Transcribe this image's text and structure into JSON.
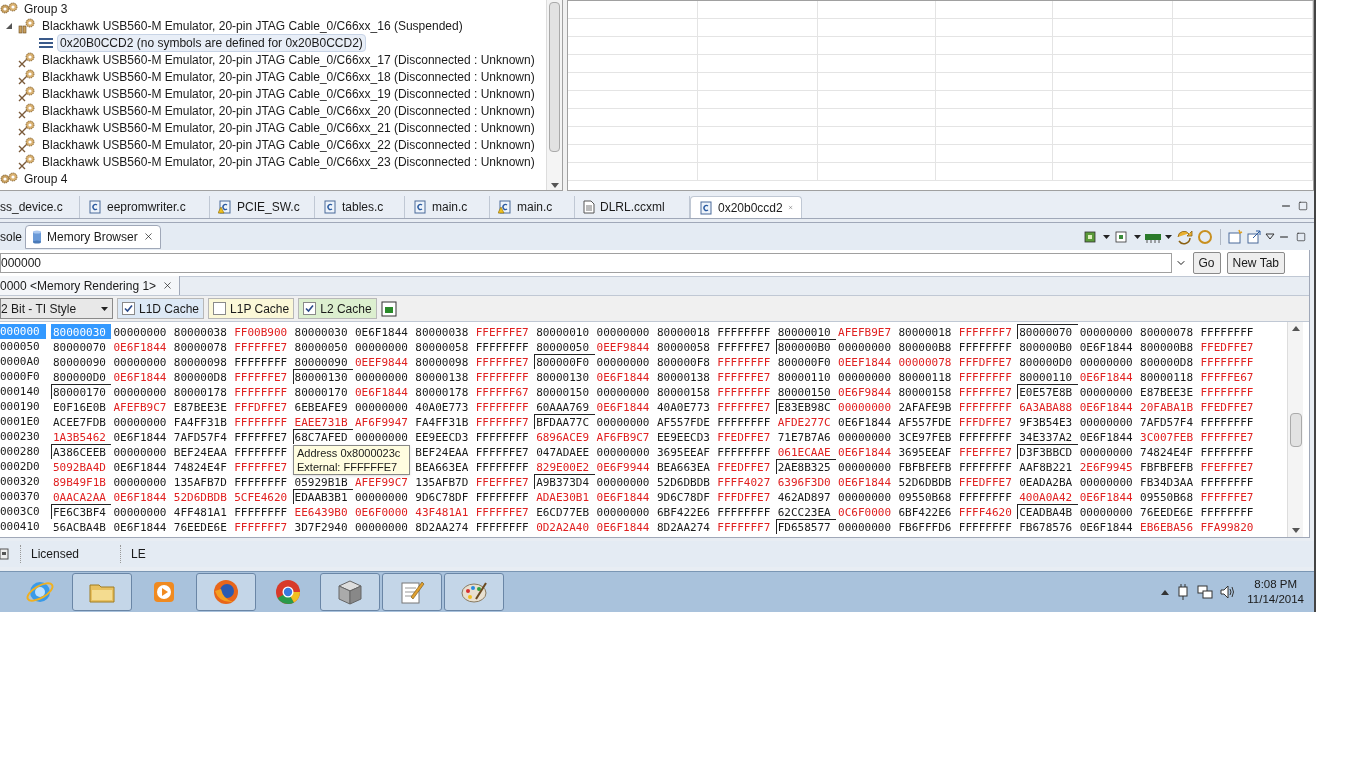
{
  "tree": [
    {
      "label": "Group 3",
      "kind": "group",
      "selected": false,
      "children": [
        {
          "label": "Blackhawk USB560-M Emulator, 20-pin JTAG Cable_0/C66xx_16 (Suspended)",
          "kind": "suspended",
          "selected": false,
          "children": [
            {
              "label": "0x20B0CCD2  (no symbols are defined for 0x20B0CCD2)",
              "kind": "frame",
              "selected": true
            }
          ]
        },
        {
          "label": "Blackhawk USB560-M Emulator, 20-pin JTAG Cable_0/C66xx_17 (Disconnected : Unknown)",
          "kind": "disconnected",
          "selected": false
        },
        {
          "label": "Blackhawk USB560-M Emulator, 20-pin JTAG Cable_0/C66xx_18 (Disconnected : Unknown)",
          "kind": "disconnected",
          "selected": false
        },
        {
          "label": "Blackhawk USB560-M Emulator, 20-pin JTAG Cable_0/C66xx_19 (Disconnected : Unknown)",
          "kind": "disconnected",
          "selected": false
        },
        {
          "label": "Blackhawk USB560-M Emulator, 20-pin JTAG Cable_0/C66xx_20 (Disconnected : Unknown)",
          "kind": "disconnected",
          "selected": false
        },
        {
          "label": "Blackhawk USB560-M Emulator, 20-pin JTAG Cable_0/C66xx_21 (Disconnected : Unknown)",
          "kind": "disconnected",
          "selected": false
        },
        {
          "label": "Blackhawk USB560-M Emulator, 20-pin JTAG Cable_0/C66xx_22 (Disconnected : Unknown)",
          "kind": "disconnected",
          "selected": false
        },
        {
          "label": "Blackhawk USB560-M Emulator, 20-pin JTAG Cable_0/C66xx_23 (Disconnected : Unknown)",
          "kind": "disconnected",
          "selected": false
        }
      ]
    },
    {
      "label": "Group 4",
      "kind": "group",
      "selected": false
    }
  ],
  "editor_tabs": [
    {
      "label": "ss_device.c",
      "kind": "none",
      "selected": false
    },
    {
      "label": "eepromwriter.c",
      "kind": "c",
      "selected": false
    },
    {
      "label": "PCIE_SW.c",
      "kind": "c-warning",
      "selected": false
    },
    {
      "label": "tables.c",
      "kind": "c",
      "selected": false
    },
    {
      "label": "main.c",
      "kind": "c",
      "selected": false
    },
    {
      "label": "main.c",
      "kind": "c-warning",
      "selected": false
    },
    {
      "label": "DLRL.ccxml",
      "kind": "xml",
      "selected": false
    },
    {
      "label": "0x20b0ccd2",
      "kind": "c",
      "selected": true
    }
  ],
  "view_tabs": [
    {
      "label": "sole",
      "kind": "none",
      "selected": false
    },
    {
      "label": "Memory Browser",
      "kind": "memory",
      "selected": true
    }
  ],
  "memory_browser": {
    "address": {
      "value": "000000"
    },
    "buttons": [
      "Go",
      "New Tab"
    ],
    "rendering_tab": "0000 <Memory Rendering 1>",
    "format": "2 Bit - TI Style",
    "caches": [
      {
        "label": "L1D Cache",
        "checked": true,
        "color": "#dde9f6"
      },
      {
        "label": "L1P Cache",
        "checked": false,
        "color": "#fbf8d8"
      },
      {
        "label": "L2 Cache",
        "checked": true,
        "color": "#dcefcf"
      }
    ],
    "rows": [
      {
        "address": "000000",
        "selected": true,
        "words": [
          "80000030",
          "00000000",
          "80000038",
          "FF00B900",
          "80000030",
          "0E6F1844",
          "80000038",
          "FFEFFFE7",
          "80000010",
          "00000000",
          "80000018",
          "FFFFFFFF",
          "80000010",
          "AFEFB9E7",
          "80000018",
          "FFFFFFF7",
          "80000070",
          "00000000",
          "80000078",
          "FFFFFFFF"
        ],
        "changed": [
          false,
          false,
          false,
          true,
          false,
          false,
          false,
          true,
          false,
          false,
          false,
          false,
          false,
          true,
          false,
          true,
          false,
          false,
          false,
          false
        ],
        "boxed": [
          false,
          false,
          false,
          false,
          false,
          false,
          false,
          false,
          false,
          false,
          false,
          false,
          false,
          false,
          false,
          false,
          true,
          false,
          false,
          false
        ]
      },
      {
        "address": "000050",
        "selected": false,
        "words": [
          "80000070",
          "0E6F1844",
          "80000078",
          "FFFFFFE7",
          "80000050",
          "00000000",
          "80000058",
          "FFFFFFFF",
          "80000050",
          "0EEF9844",
          "80000058",
          "FFFFFFE7",
          "800000B0",
          "00000000",
          "800000B8",
          "FFFFFFFF",
          "800000B0",
          "0E6F1844",
          "800000B8",
          "FFEDFFE7"
        ],
        "changed": [
          false,
          true,
          false,
          true,
          false,
          false,
          false,
          false,
          false,
          true,
          false,
          false,
          false,
          false,
          false,
          false,
          false,
          false,
          false,
          true
        ],
        "boxed": [
          false,
          false,
          false,
          false,
          false,
          false,
          false,
          false,
          false,
          false,
          false,
          false,
          true,
          false,
          false,
          false,
          false,
          false,
          false,
          false
        ]
      },
      {
        "address": "0000A0",
        "selected": false,
        "words": [
          "80000090",
          "00000000",
          "80000098",
          "FFFFFFFF",
          "80000090",
          "0EEF9844",
          "80000098",
          "FFFFFFE7",
          "800000F0",
          "00000000",
          "800000F8",
          "FFFFFFFF",
          "800000F0",
          "0EEF1844",
          "00000078",
          "FFFDFFE7",
          "800000D0",
          "00000000",
          "800000D8",
          "FFFFFFFF"
        ],
        "changed": [
          false,
          false,
          false,
          false,
          false,
          true,
          false,
          true,
          false,
          false,
          false,
          true,
          false,
          true,
          true,
          true,
          false,
          false,
          false,
          true
        ],
        "boxed": [
          false,
          false,
          false,
          false,
          false,
          false,
          false,
          false,
          true,
          false,
          false,
          false,
          false,
          false,
          false,
          false,
          false,
          false,
          false,
          false
        ]
      },
      {
        "address": "0000F0",
        "selected": false,
        "words": [
          "800000D0",
          "0E6F1844",
          "800000D8",
          "FFFFFFE7",
          "80000130",
          "00000000",
          "80000138",
          "FFFFFFFF",
          "80000130",
          "0E6F1844",
          "80000138",
          "FFFFFFE7",
          "80000110",
          "00000000",
          "80000118",
          "FFFFFFFF",
          "80000110",
          "0E6F1844",
          "80000118",
          "FFFFFE67"
        ],
        "changed": [
          false,
          true,
          false,
          true,
          false,
          false,
          false,
          true,
          false,
          true,
          false,
          true,
          false,
          false,
          false,
          true,
          false,
          true,
          false,
          true
        ],
        "boxed": [
          false,
          false,
          false,
          false,
          true,
          false,
          false,
          false,
          false,
          false,
          false,
          false,
          false,
          false,
          false,
          false,
          false,
          false,
          false,
          false
        ]
      },
      {
        "address": "000140",
        "selected": false,
        "words": [
          "80000170",
          "00000000",
          "80000178",
          "FFFFFFFF",
          "80000170",
          "0E6F1844",
          "80000178",
          "FFFFFF67",
          "80000150",
          "00000000",
          "80000158",
          "FFFFFFFF",
          "80000150",
          "0E6F9844",
          "80000158",
          "FFFFFFE7",
          "E0E57E8B",
          "00000000",
          "E87BEE3E",
          "FFFFFFFF"
        ],
        "changed": [
          false,
          false,
          false,
          true,
          false,
          true,
          false,
          true,
          false,
          false,
          false,
          true,
          false,
          true,
          false,
          true,
          false,
          false,
          false,
          true
        ],
        "boxed": [
          true,
          false,
          false,
          false,
          false,
          false,
          false,
          false,
          false,
          false,
          false,
          false,
          false,
          false,
          false,
          false,
          true,
          false,
          false,
          false
        ]
      },
      {
        "address": "000190",
        "selected": false,
        "words": [
          "E0F16E0B",
          "AFEFB9C7",
          "E87BEE3E",
          "FFFDFFE7",
          "6EBEAFE9",
          "00000000",
          "40A0E773",
          "FFFFFFFF",
          "60AAA769",
          "0E6F1844",
          "40A0E773",
          "FFFFFFE7",
          "E83EB98C",
          "00000000",
          "2AFAFE9B",
          "FFFFFFFF",
          "6A3ABA88",
          "0E6F1844",
          "20FABA1B",
          "FFEDFFE7"
        ],
        "changed": [
          false,
          true,
          false,
          true,
          false,
          false,
          false,
          true,
          false,
          true,
          false,
          true,
          false,
          true,
          false,
          true,
          true,
          true,
          true,
          true
        ],
        "boxed": [
          false,
          false,
          false,
          false,
          false,
          false,
          false,
          false,
          false,
          false,
          false,
          false,
          true,
          false,
          false,
          false,
          false,
          false,
          false,
          false
        ]
      },
      {
        "address": "0001E0",
        "selected": false,
        "words": [
          "ACEE7FDB",
          "00000000",
          "FA4FF31B",
          "FFFFFFFF",
          "EAEE731B",
          "AF6F9947",
          "FA4FF31B",
          "FFFFFFF7",
          "BFDAA77C",
          "00000000",
          "AF557FDE",
          "FFFFFFFF",
          "AFDE277C",
          "0E6F1844",
          "AF557FDE",
          "FFFDFFE7",
          "9F3B54E3",
          "00000000",
          "7AFD57F4",
          "FFFFFFFF"
        ],
        "changed": [
          false,
          false,
          false,
          true,
          true,
          true,
          false,
          true,
          false,
          false,
          false,
          false,
          true,
          false,
          false,
          true,
          false,
          false,
          false,
          false
        ],
        "boxed": [
          false,
          false,
          false,
          false,
          false,
          false,
          false,
          false,
          true,
          false,
          false,
          false,
          false,
          false,
          false,
          false,
          false,
          false,
          false,
          false
        ]
      },
      {
        "address": "000230",
        "selected": false,
        "words": [
          "1A3B5462",
          "0E6F1844",
          "7AFD57F4",
          "FFFFFFE7",
          "68C7AFED",
          "00000000",
          "EE9EECD3",
          "FFFFFFFF",
          "6896ACE9",
          "AF6FB9C7",
          "EE9EECD3",
          "FFEDFFE7",
          "71E7B7A6",
          "00000000",
          "3CE97FEB",
          "FFFFFFFF",
          "34E337A2",
          "0E6F1844",
          "3C007FEB",
          "FFFFFFE7"
        ],
        "changed": [
          true,
          false,
          false,
          false,
          false,
          false,
          false,
          false,
          true,
          true,
          false,
          true,
          false,
          false,
          false,
          false,
          false,
          false,
          true,
          true
        ],
        "boxed": [
          false,
          false,
          false,
          false,
          true,
          false,
          false,
          false,
          false,
          false,
          false,
          false,
          false,
          false,
          false,
          false,
          false,
          false,
          false,
          false
        ]
      },
      {
        "address": "000280",
        "selected": false,
        "covered": true,
        "words": [
          "A386CEEB",
          "00000000",
          "BEF24EAA",
          "FFFFFFFF",
          "BEF24EAA",
          "FFFFFFE7",
          "047ADAEE",
          "00000000",
          "3695EEAF",
          "FFFFFFFF",
          "061ECAAE",
          "0E6F1844",
          "3695EEAF",
          "FFEFFFE7",
          "D3F3BBCD",
          "00000000",
          "74824E4F",
          "FFFFFFFF"
        ],
        "changed": [
          false,
          false,
          false,
          false,
          false,
          false,
          false,
          false,
          false,
          false,
          true,
          true,
          false,
          true,
          false,
          false,
          false,
          false
        ],
        "boxed": [
          true,
          false,
          false,
          false,
          false,
          false,
          false,
          false,
          false,
          false,
          false,
          false,
          false,
          false,
          true,
          false,
          false,
          false
        ]
      },
      {
        "address": "0002D0",
        "selected": false,
        "covered": true,
        "words": [
          "5092BA4D",
          "0E6F1844",
          "74824E4F",
          "FFFFFFE7",
          "BEA663EA",
          "FFFFFFFF",
          "829E00E2",
          "0E6F9944",
          "BEA663EA",
          "FFEDFFE7",
          "2AE8B325",
          "00000000",
          "FBFBFEFB",
          "FFFFFFFF",
          "AAF8B221",
          "2E6F9945",
          "FBFBFEFB",
          "FFEFFFE7"
        ],
        "changed": [
          true,
          false,
          false,
          true,
          false,
          false,
          true,
          true,
          false,
          true,
          false,
          false,
          false,
          false,
          false,
          true,
          false,
          true
        ],
        "boxed": [
          false,
          false,
          false,
          false,
          false,
          false,
          false,
          false,
          false,
          false,
          true,
          false,
          false,
          false,
          false,
          false,
          false,
          false
        ]
      },
      {
        "address": "000320",
        "selected": false,
        "words": [
          "89B49F1B",
          "00000000",
          "135AFB7D",
          "FFFFFFFF",
          "05929B1B",
          "AFEF99C7",
          "135AFB7D",
          "FFEFFFE7",
          "A9B373D4",
          "00000000",
          "52D6DBDB",
          "FFFF4027",
          "6396F3D0",
          "0E6F1844",
          "52D6DBDB",
          "FFEDFFE7",
          "0EADA2BA",
          "00000000",
          "FB34D3AA",
          "FFFFFFFF"
        ],
        "changed": [
          true,
          false,
          false,
          false,
          false,
          true,
          false,
          true,
          false,
          false,
          false,
          true,
          true,
          true,
          false,
          true,
          false,
          false,
          false,
          false
        ],
        "boxed": [
          false,
          false,
          false,
          false,
          false,
          false,
          false,
          false,
          true,
          false,
          false,
          false,
          false,
          false,
          false,
          false,
          false,
          false,
          false,
          false
        ]
      },
      {
        "address": "000370",
        "selected": false,
        "words": [
          "0AACA2AA",
          "0E6F1844",
          "52D6DBDB",
          "5CFE4620",
          "EDAAB3B1",
          "00000000",
          "9D6C78DF",
          "FFFFFFFF",
          "ADAE30B1",
          "0E6F1844",
          "9D6C78DF",
          "FFFDFFE7",
          "462AD897",
          "00000000",
          "09550B68",
          "FFFFFFFF",
          "400A0A42",
          "0E6F1844",
          "09550B68",
          "FFFFFFE7"
        ],
        "changed": [
          true,
          true,
          true,
          true,
          false,
          false,
          false,
          false,
          true,
          true,
          false,
          true,
          false,
          false,
          false,
          false,
          true,
          true,
          false,
          true
        ],
        "boxed": [
          false,
          false,
          false,
          false,
          true,
          false,
          false,
          false,
          false,
          false,
          false,
          false,
          false,
          false,
          false,
          false,
          false,
          false,
          false,
          false
        ]
      },
      {
        "address": "0003C0",
        "selected": false,
        "words": [
          "FE6C3BF4",
          "00000000",
          "4FF481A1",
          "FFFFFFFF",
          "EE6439B0",
          "0E6F0000",
          "43F481A1",
          "FFFFFFE7",
          "E6CD77EB",
          "00000000",
          "6BF422E6",
          "FFFFFFFF",
          "62CC23EA",
          "0C6F0000",
          "6BF422E6",
          "FFFF4620",
          "CEADBA4B",
          "00000000",
          "76EEDE6E",
          "FFFFFFFF"
        ],
        "changed": [
          false,
          false,
          false,
          false,
          true,
          true,
          true,
          true,
          false,
          false,
          false,
          false,
          false,
          true,
          false,
          true,
          false,
          false,
          false,
          false
        ],
        "boxed": [
          true,
          false,
          false,
          false,
          false,
          false,
          false,
          false,
          false,
          false,
          false,
          false,
          false,
          false,
          false,
          false,
          true,
          false,
          false,
          false
        ]
      },
      {
        "address": "000410",
        "selected": false,
        "words": [
          "56ACBA4B",
          "0E6F1844",
          "76EEDE6E",
          "FFFFFFF7",
          "3D7F2940",
          "00000000",
          "8D2AA274",
          "FFFFFFFF",
          "0D2A2A40",
          "0E6F1844",
          "8D2AA274",
          "FFFFFFF7",
          "FD658577",
          "00000000",
          "FB6FFFD6",
          "FFFFFFFF",
          "FB678576",
          "0E6F1844",
          "EB6EBA56",
          "FFA99820"
        ],
        "changed": [
          false,
          false,
          false,
          true,
          false,
          false,
          false,
          false,
          true,
          true,
          false,
          true,
          false,
          false,
          false,
          false,
          false,
          false,
          true,
          true
        ],
        "boxed": [
          false,
          false,
          false,
          false,
          false,
          false,
          false,
          false,
          false,
          false,
          false,
          false,
          true,
          false,
          false,
          false,
          false,
          false,
          false,
          false
        ]
      }
    ],
    "tooltip": [
      "Address 0x8000023c",
      "External: FFFFFFE7"
    ]
  },
  "status_bar": [
    "Licensed",
    "LE"
  ],
  "taskbar": {
    "apps": [
      {
        "kind": "ie",
        "running": false
      },
      {
        "kind": "explorer",
        "running": true
      },
      {
        "kind": "media",
        "running": false
      },
      {
        "kind": "firefox",
        "running": true
      },
      {
        "kind": "chrome",
        "running": false
      },
      {
        "kind": "cube",
        "running": true
      },
      {
        "kind": "notepad",
        "running": true
      },
      {
        "kind": "paint",
        "running": true
      }
    ],
    "time": "8:08 PM",
    "date": "11/14/2014"
  }
}
